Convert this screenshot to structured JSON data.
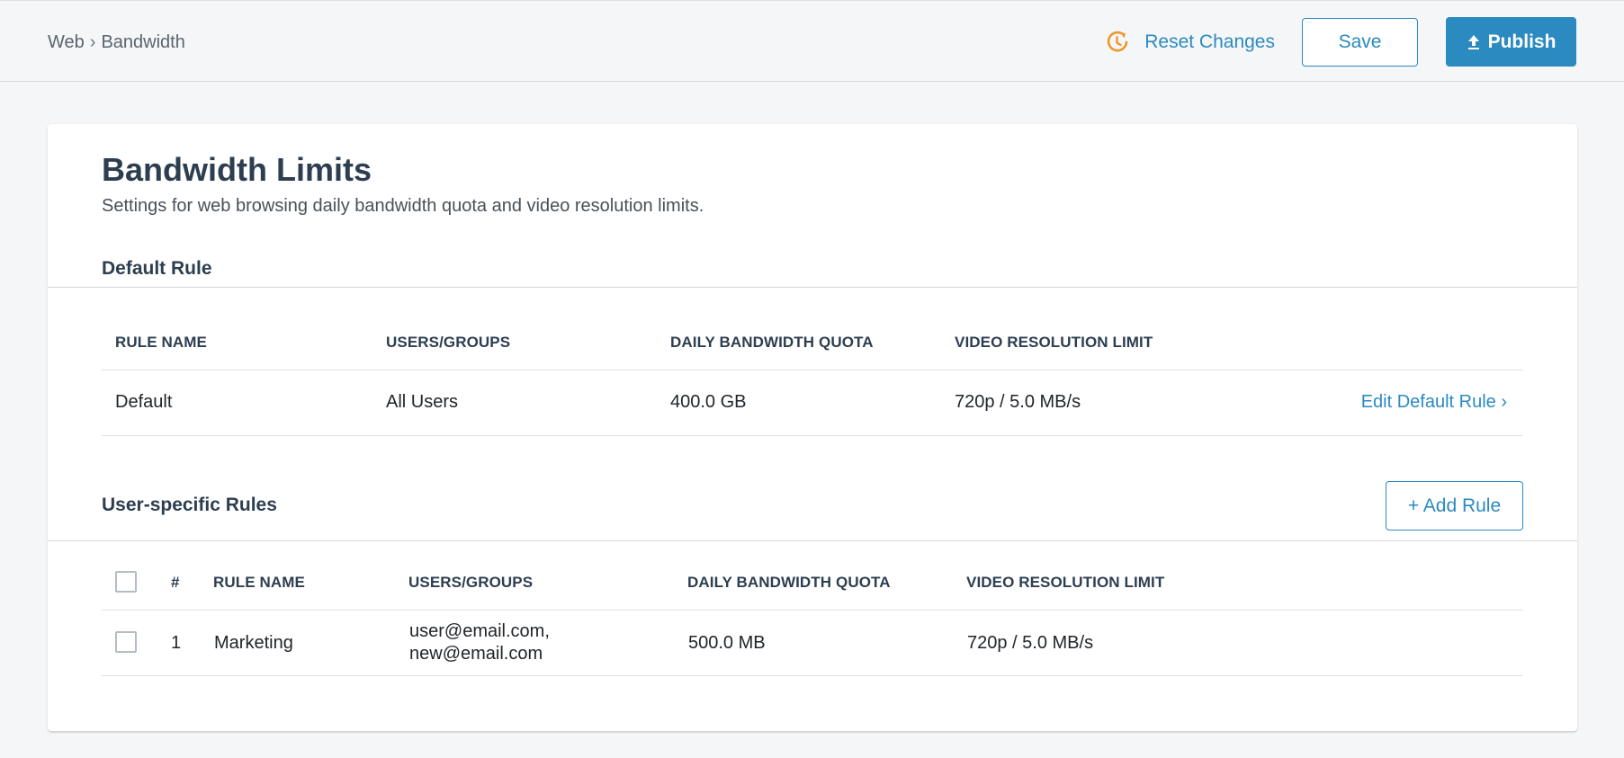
{
  "breadcrumb": {
    "parent": "Web",
    "separator": "›",
    "current": "Bandwidth"
  },
  "actions": {
    "reset_label": "Reset Changes",
    "save_label": "Save",
    "publish_label": "Publish"
  },
  "page": {
    "title": "Bandwidth Limits",
    "subtitle": "Settings for web browsing daily bandwidth quota and video resolution limits."
  },
  "default_rule": {
    "heading": "Default Rule",
    "columns": [
      "RULE NAME",
      "USERS/GROUPS",
      "DAILY BANDWIDTH QUOTA",
      "VIDEO RESOLUTION LIMIT"
    ],
    "row": {
      "name": "Default",
      "users": "All Users",
      "quota": "400.0 GB",
      "video": "720p / 5.0 MB/s"
    },
    "edit_label": "Edit Default Rule ›"
  },
  "user_rules": {
    "heading": "User-specific Rules",
    "add_label": "+ Add Rule",
    "columns": [
      "#",
      "RULE NAME",
      "USERS/GROUPS",
      "DAILY BANDWIDTH QUOTA",
      "VIDEO RESOLUTION LIMIT"
    ],
    "rows": [
      {
        "num": "1",
        "name": "Marketing",
        "users_line1": "user@email.com,",
        "users_line2": "new@email.com",
        "quota": "500.0 MB",
        "video": "720p / 5.0 MB/s"
      }
    ]
  },
  "colors": {
    "accent": "#2b8ac0",
    "reset_icon": "#f0962a",
    "heading": "#2c3e50"
  },
  "icons": {
    "reset": "history-clock-icon",
    "publish": "upload-icon"
  }
}
